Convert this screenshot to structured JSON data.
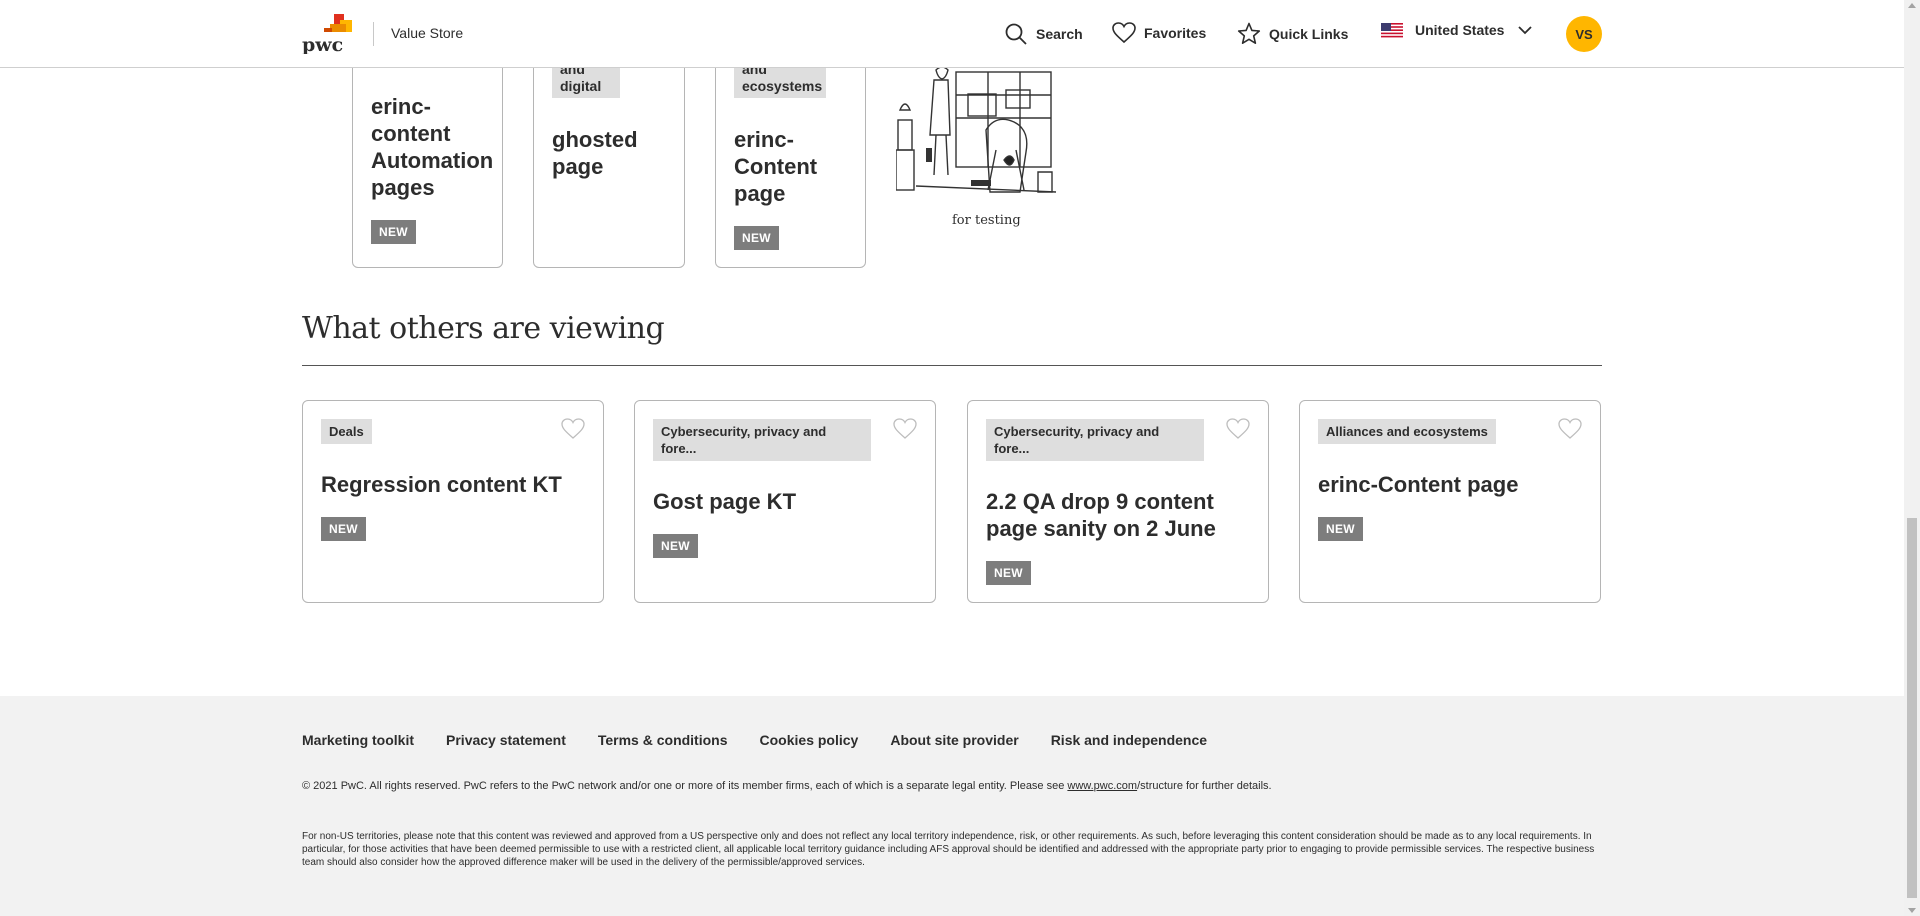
{
  "header": {
    "site_name": "Value Store",
    "search_label": "Search",
    "favorites_label": "Favorites",
    "quicklinks_label": "Quick Links",
    "country_label": "United States",
    "avatar_initials": "VS"
  },
  "top_cards": [
    {
      "tag_fragment": "",
      "title": "erinc-content Automation pages",
      "badge": "NEW"
    },
    {
      "tag_fragment": "and digital",
      "title": "ghosted page",
      "badge": ""
    },
    {
      "tag_fragment": "and ecosystems",
      "title": "erinc-Content page",
      "badge": "NEW"
    }
  ],
  "cartoon_caption": "for testing",
  "section": {
    "title": "What others are viewing"
  },
  "viewing_cards": [
    {
      "tag": "Deals",
      "title": "Regression content KT",
      "badge": "NEW"
    },
    {
      "tag": "Cybersecurity, privacy and fore...",
      "title": "Gost page KT",
      "badge": "NEW"
    },
    {
      "tag": "Cybersecurity, privacy and fore...",
      "title": "2.2 QA drop 9 content page sanity on 2 June",
      "badge": "NEW"
    },
    {
      "tag": "Alliances and ecosystems",
      "title": "erinc-Content page",
      "badge": "NEW"
    }
  ],
  "footer": {
    "links": [
      "Marketing toolkit",
      "Privacy statement",
      "Terms & conditions",
      "Cookies policy",
      "About site provider",
      "Risk and independence"
    ],
    "copyright_pre": "© 2021 PwC. All rights reserved. PwC refers to the PwC network and/or one or more of its member firms, each of which is a separate legal entity. Please see ",
    "copyright_link": "www.pwc.com",
    "copyright_post": "/structure for further details.",
    "disclaimer": "For non-US territories, please note that this content was reviewed and approved from a US perspective only and does not reflect any local territory independence, risk, or other requirements. As such, before leveraging this content consideration should be made as to any local requirements. In particular, for those activities that have been deemed permissible to use with a restricted client, all applicable local territory guidance including AFS approval should be identified and addressed with the appropriate party prior to engaging to provide permissible services. The respective business team should also consider how the approved difference maker will be used in the delivery of the permissible/approved services."
  },
  "colors": {
    "accent": "#ffb600",
    "badge": "#7d7d7d",
    "tag_bg": "#dedede",
    "footer_bg": "#f2f2f2"
  }
}
